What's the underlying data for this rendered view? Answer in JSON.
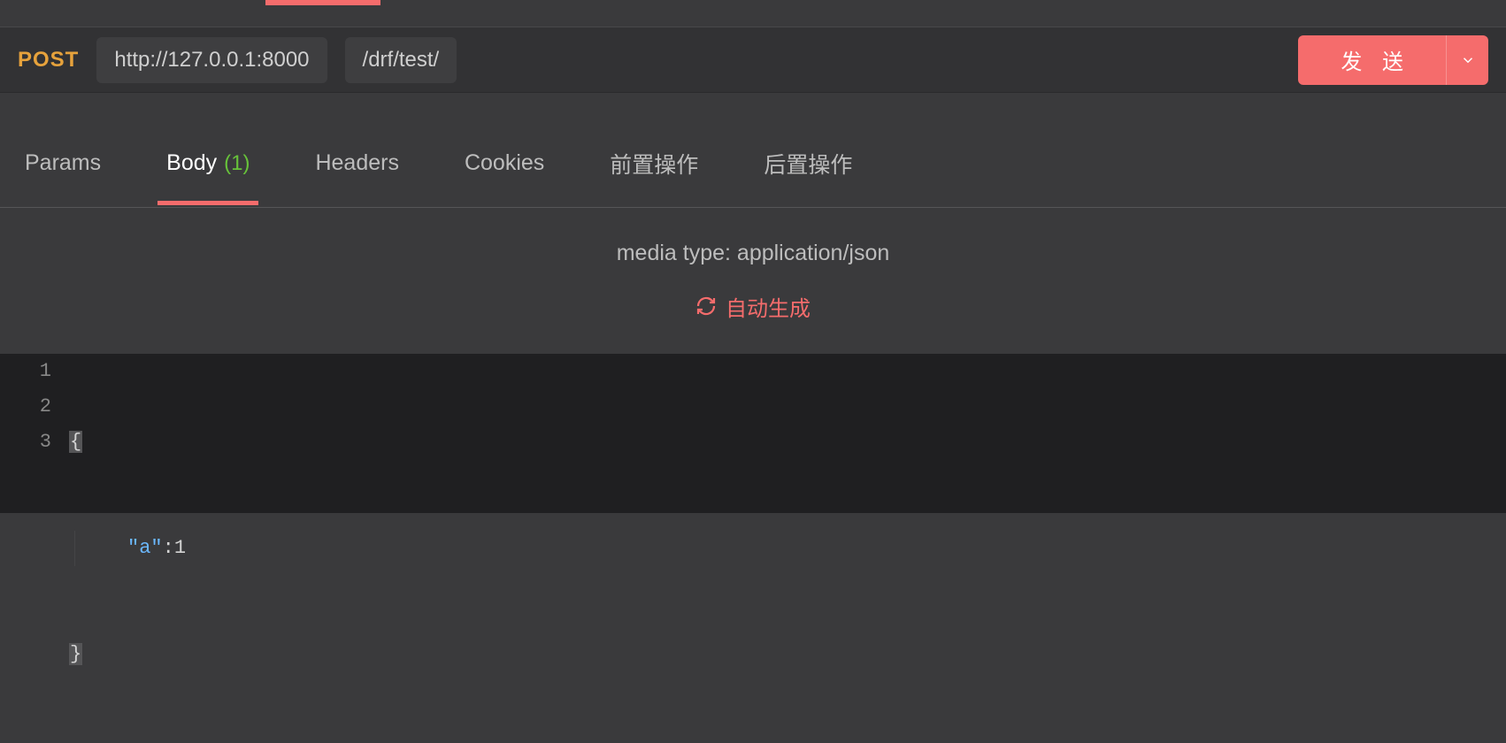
{
  "request": {
    "method": "POST",
    "base_url": "http://127.0.0.1:8000",
    "path": "/drf/test/",
    "send_label": "发 送"
  },
  "tabs": {
    "params": "Params",
    "body_label": "Body",
    "body_count": "(1)",
    "headers": "Headers",
    "cookies": "Cookies",
    "pre": "前置操作",
    "post": "后置操作"
  },
  "body_opts": {
    "media_type": "media type: application/json",
    "auto_gen": "自动生成"
  },
  "editor": {
    "lines": {
      "l1_num": "1",
      "l1_text": "{",
      "l2_num": "2",
      "l2_key": "\"a\"",
      "l2_colon": ":",
      "l2_val": "1",
      "l3_num": "3",
      "l3_text": "}"
    }
  }
}
